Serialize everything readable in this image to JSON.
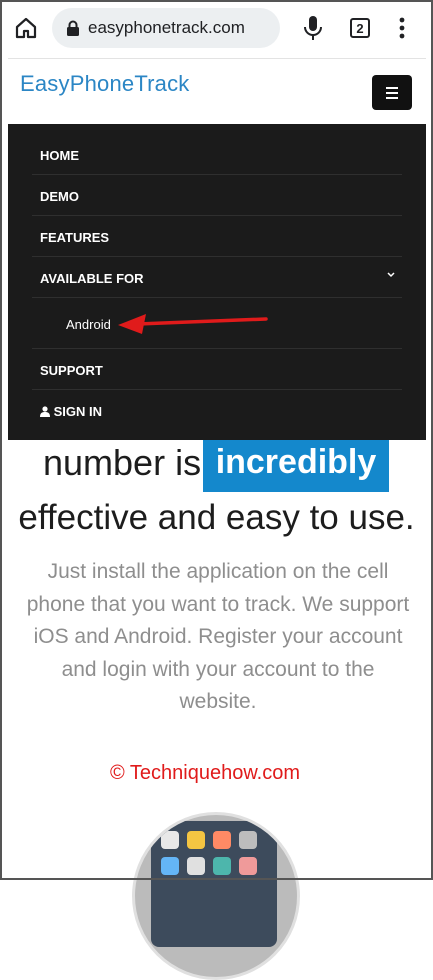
{
  "browser": {
    "url": "easyphonetrack.com",
    "tab_count": "2"
  },
  "site": {
    "logo_text": "EasyPhoneTrack"
  },
  "nav": {
    "items": [
      {
        "label": "HOME"
      },
      {
        "label": "DEMO"
      },
      {
        "label": "FEATURES"
      },
      {
        "label": "AVAILABLE FOR"
      },
      {
        "label": "Android"
      },
      {
        "label": "SUPPORT"
      },
      {
        "label": "SIGN IN"
      }
    ]
  },
  "content": {
    "headline_part1": "number is",
    "headline_highlight": "incredibly",
    "headline_part2": "effective and easy to use.",
    "paragraph": "Just install the application on the cell phone that you want to track. We support iOS and Android. Register your account and login with your account to the website.",
    "credit": "© Techniquehow.com"
  },
  "colors": {
    "accent": "#1488cc",
    "nav_bg": "#1b1b1b",
    "annotation_red": "#e01b1b"
  }
}
